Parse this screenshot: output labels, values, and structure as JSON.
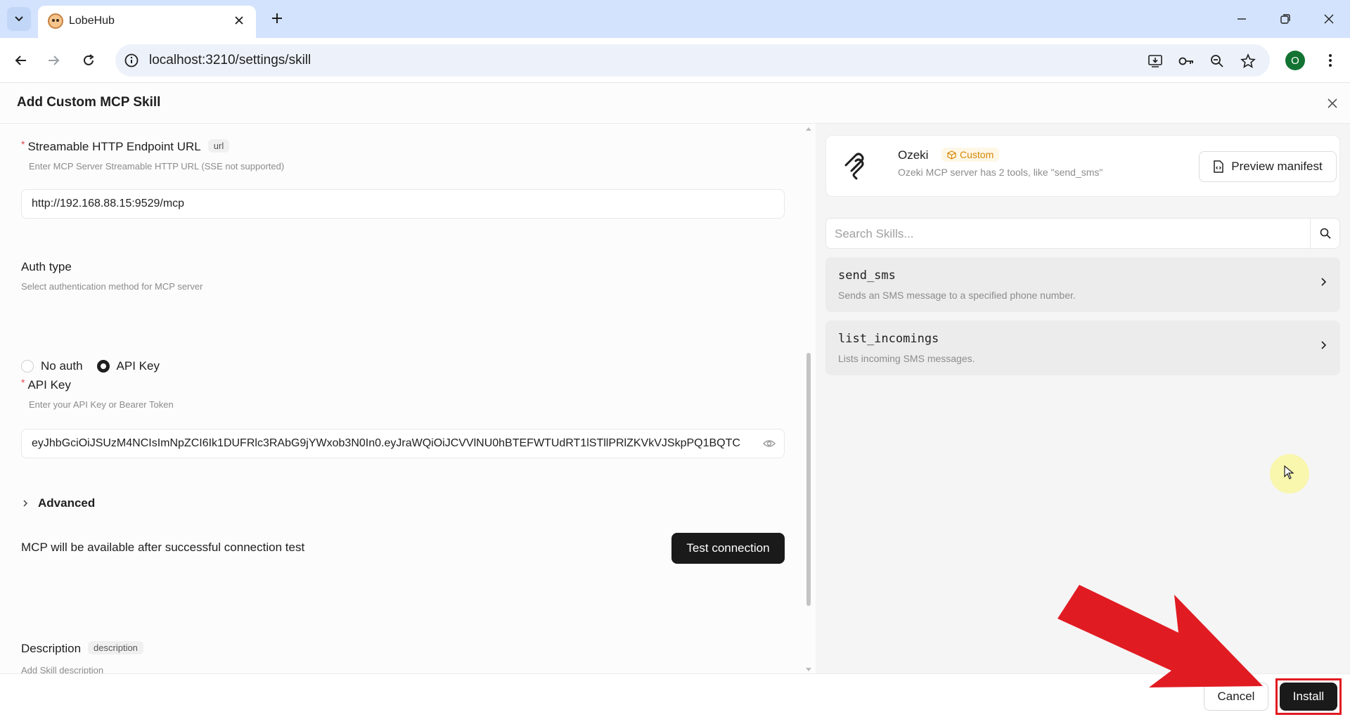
{
  "browser": {
    "tab_title": "LobeHub",
    "url": "localhost:3210/settings/skill",
    "profile_initial": "O"
  },
  "modal": {
    "title": "Add Custom MCP Skill",
    "endpoint": {
      "label": "Streamable HTTP Endpoint URL",
      "tag": "url",
      "hint": "Enter MCP Server Streamable HTTP URL (SSE not supported)",
      "value": "http://192.168.88.15:9529/mcp"
    },
    "auth": {
      "label": "Auth type",
      "hint": "Select authentication method for MCP server",
      "options": [
        "No auth",
        "API Key"
      ],
      "selected": "API Key"
    },
    "api_key": {
      "label": "API Key",
      "hint": "Enter your API Key or Bearer Token",
      "value": "eyJhbGciOiJSUzM4NCIsImNpZCI6Ik1DUFRlc3RAbG9jYWxob3N0In0.eyJraWQiOiJCVVlNU0hBTEFWTUdRT1lSTllPRlZKVkVJSkpPQ1BQTC"
    },
    "advanced_label": "Advanced",
    "connection_note": "MCP will be available after successful connection test",
    "test_button": "Test connection",
    "description": {
      "label": "Description",
      "tag": "description",
      "hint": "Add Skill description"
    },
    "cancel_button": "Cancel",
    "install_button": "Install"
  },
  "preview": {
    "name": "Ozeki",
    "badge": "Custom",
    "summary": "Ozeki MCP server has 2 tools, like \"send_sms\"",
    "preview_button": "Preview manifest",
    "search_placeholder": "Search Skills...",
    "tools": [
      {
        "name": "send_sms",
        "description": "Sends an SMS message to a specified phone number."
      },
      {
        "name": "list_incomings",
        "description": "Lists incoming SMS messages."
      }
    ]
  },
  "colors": {
    "accent_dark": "#1a1a1a",
    "badge": "#d48806",
    "highlight_red": "#e11b22"
  }
}
